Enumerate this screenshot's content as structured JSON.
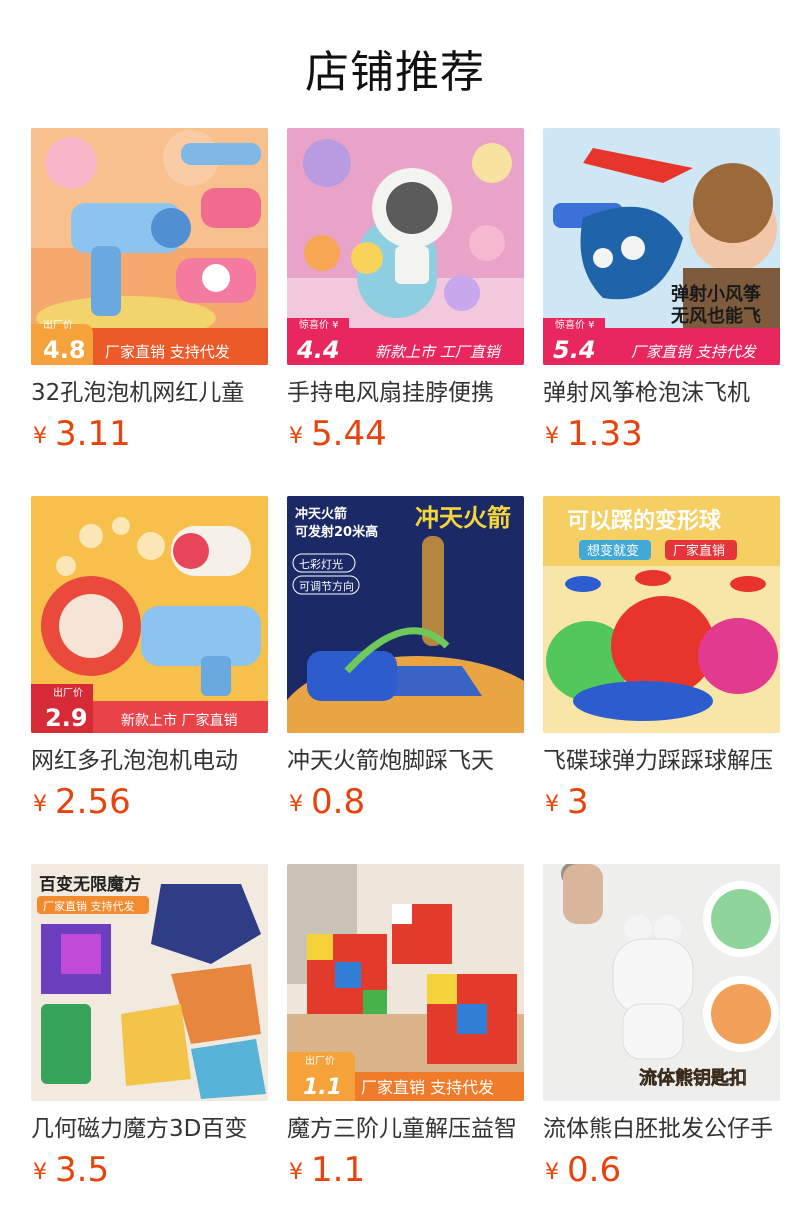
{
  "page": {
    "title": "店铺推荐"
  },
  "colors": {
    "price": "#e8430e",
    "badge_red": "#e94a2a",
    "badge_orange": "#f07b2b"
  },
  "products": [
    {
      "name": "32孔泡泡机网红儿童",
      "currency": "¥",
      "price": "3.11",
      "image": {
        "theme": "bubble-gun-orange",
        "badge_label": "出厂价",
        "badge_price": "4.8",
        "banner": "厂家直销 支持代发",
        "overlay": ""
      }
    },
    {
      "name": "手持电风扇挂脖便携",
      "currency": "¥",
      "price": "5.44",
      "image": {
        "theme": "fans-pink",
        "badge_label": "惊喜价 ¥",
        "badge_price": "4.4",
        "banner": "新款上市 工厂直销",
        "overlay": ""
      }
    },
    {
      "name": "弹射风筝枪泡沫飞机",
      "currency": "¥",
      "price": "1.33",
      "image": {
        "theme": "kite-gun-boy",
        "badge_label": "惊喜价 ¥",
        "badge_price": "5.4",
        "banner": "厂家直销 支持代发",
        "overlay": "弹射小风筝 无风也能飞"
      }
    },
    {
      "name": "网红多孔泡泡机电动",
      "currency": "¥",
      "price": "2.56",
      "image": {
        "theme": "bubble-machine-yellow",
        "badge_label": "出厂价",
        "badge_price": "2.9",
        "banner": "新款上市 厂家直销",
        "overlay": ""
      }
    },
    {
      "name": "冲天火箭炮脚踩飞天",
      "currency": "¥",
      "price": "0.8",
      "image": {
        "theme": "rocket-space",
        "badge_label": "",
        "badge_price": "",
        "banner": "",
        "overlay": "冲天火箭",
        "tags": [
          "冲天火箭",
          "可发射20米高",
          "七彩灯光",
          "可调节方向"
        ]
      }
    },
    {
      "name": "飞碟球弹力踩踩球解压",
      "currency": "¥",
      "price": "3",
      "image": {
        "theme": "ufo-ball",
        "badge_label": "",
        "badge_price": "",
        "banner": "",
        "overlay": "可以踩的变形球",
        "tags": [
          "想变就变",
          "厂家直销"
        ]
      }
    },
    {
      "name": "几何磁力魔方3D百变",
      "currency": "¥",
      "price": "3.5",
      "image": {
        "theme": "magic-cube-3d",
        "badge_label": "",
        "badge_price": "",
        "banner": "",
        "overlay": "百变无限魔方",
        "tags": [
          "厂家直销 支持代发"
        ]
      }
    },
    {
      "name": "魔方三阶儿童解压益智",
      "currency": "¥",
      "price": "1.1",
      "image": {
        "theme": "rubiks-cubes",
        "badge_label": "出厂价",
        "badge_price": "1.1",
        "banner": "厂家直销 支持代发",
        "overlay": ""
      }
    },
    {
      "name": "流体熊白胚批发公仔手",
      "currency": "¥",
      "price": "0.6",
      "image": {
        "theme": "fluid-bear",
        "badge_label": "",
        "badge_price": "",
        "banner": "",
        "overlay": "流体熊钥匙扣"
      }
    }
  ]
}
